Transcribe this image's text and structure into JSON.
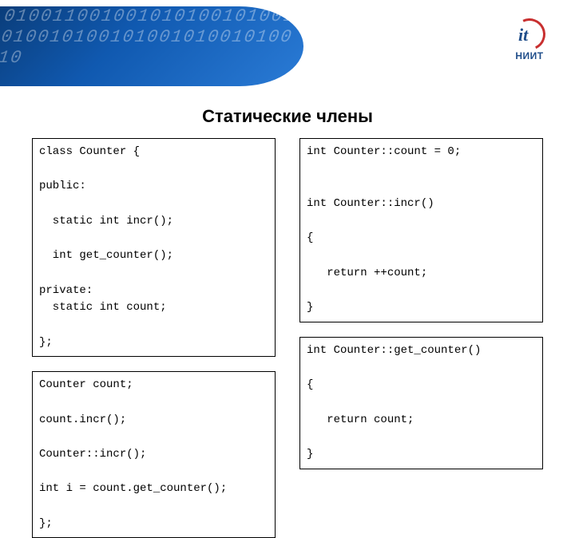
{
  "logo": {
    "abbr": "it",
    "label": "НИИТ"
  },
  "title": "Статические члены",
  "code": {
    "left1": "class Counter {\n\npublic:\n\n  static int incr();\n\n  int get_counter();\n\nprivate:\n  static int count;\n\n};",
    "left2": "Counter count;\n\ncount.incr();\n\nCounter::incr();\n\nint i = count.get_counter();\n\n};",
    "right1": "int Counter::count = 0;\n\n\nint Counter::incr()\n\n{\n\n   return ++count;\n\n}",
    "right2": "int Counter::get_counter()\n\n{\n\n   return count;\n\n}"
  }
}
